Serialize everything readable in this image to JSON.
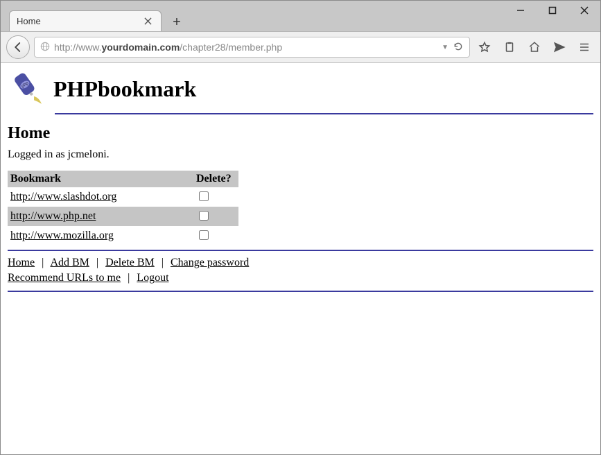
{
  "window": {
    "tab_title": "Home"
  },
  "urlbar": {
    "prefix": "http://www.",
    "bold": "yourdomain.com",
    "suffix": "/chapter28/member.php"
  },
  "app": {
    "title": "PHPbookmark",
    "logo_text": "php"
  },
  "page": {
    "heading": "Home",
    "status": "Logged in as jcmeloni."
  },
  "table": {
    "col_bookmark": "Bookmark",
    "col_delete": "Delete?",
    "rows": [
      {
        "url": "http://www.slashdot.org",
        "highlight": false
      },
      {
        "url": "http://www.php.net",
        "highlight": true
      },
      {
        "url": "http://www.mozilla.org",
        "highlight": false
      }
    ]
  },
  "footer": {
    "home": "Home",
    "add_bm": "Add BM",
    "delete_bm": "Delete BM",
    "change_pw": "Change password",
    "recommend": "Recommend URLs to me",
    "logout": "Logout"
  }
}
